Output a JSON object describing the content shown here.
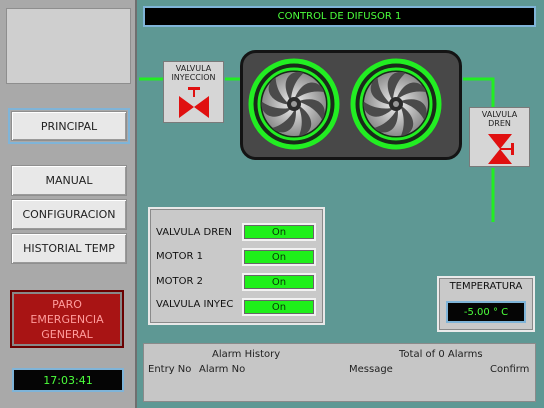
{
  "title": "CONTROL DE DIFUSOR 1",
  "nav": {
    "principal": "PRINCIPAL",
    "manual": "MANUAL",
    "configuracion": "CONFIGURACION",
    "historial": "HISTORIAL TEMP"
  },
  "emergency": {
    "line1": "PARO",
    "line2": "EMERGENCIA",
    "line3": "GENERAL"
  },
  "clock": "17:03:41",
  "valves": {
    "inyeccion": {
      "line1": "VALVULA",
      "line2": "INYECCION"
    },
    "dren": {
      "line1": "VALVULA",
      "line2": "DREN"
    }
  },
  "status": {
    "rows": [
      {
        "label": "VALVULA DREN",
        "value": "On"
      },
      {
        "label": "MOTOR 1",
        "value": "On"
      },
      {
        "label": "MOTOR 2",
        "value": "On"
      },
      {
        "label": "VALVULA INYEC",
        "value": "On"
      }
    ]
  },
  "temperature": {
    "title": "TEMPERATURA",
    "value": "-5.00 ° C"
  },
  "alarm": {
    "title": "Alarm History",
    "total": "Total of 0 Alarms",
    "columns": {
      "entry": "Entry No",
      "alarm": "Alarm No",
      "message": "Message",
      "confirm": "Confirm"
    }
  },
  "colors": {
    "background": "#5e9894",
    "pipe": "#22ee22",
    "active": "#1ff01a",
    "valve": "#e01010",
    "emergency": "#a81414"
  },
  "icons": {
    "valve": "valve-icon",
    "fan": "fan-icon"
  }
}
